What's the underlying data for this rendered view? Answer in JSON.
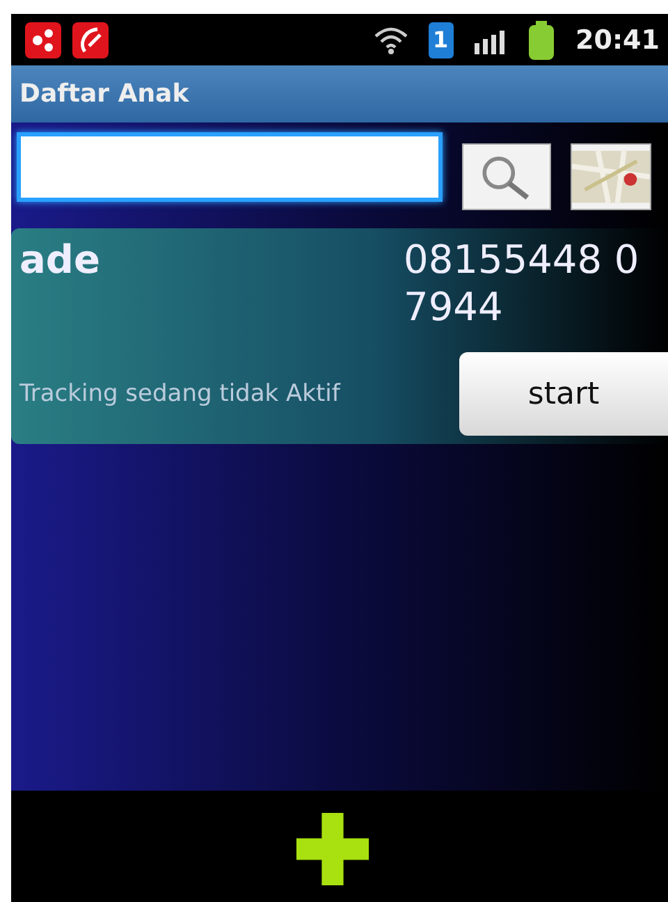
{
  "status_bar": {
    "sim_badge": "1",
    "time": "20:41"
  },
  "title_bar": {
    "title": "Daftar Anak"
  },
  "children": [
    {
      "name": "ade",
      "phone": "08155448 0 7944",
      "tracking_status": "Tracking sedang tidak Aktif",
      "button": "start"
    }
  ]
}
